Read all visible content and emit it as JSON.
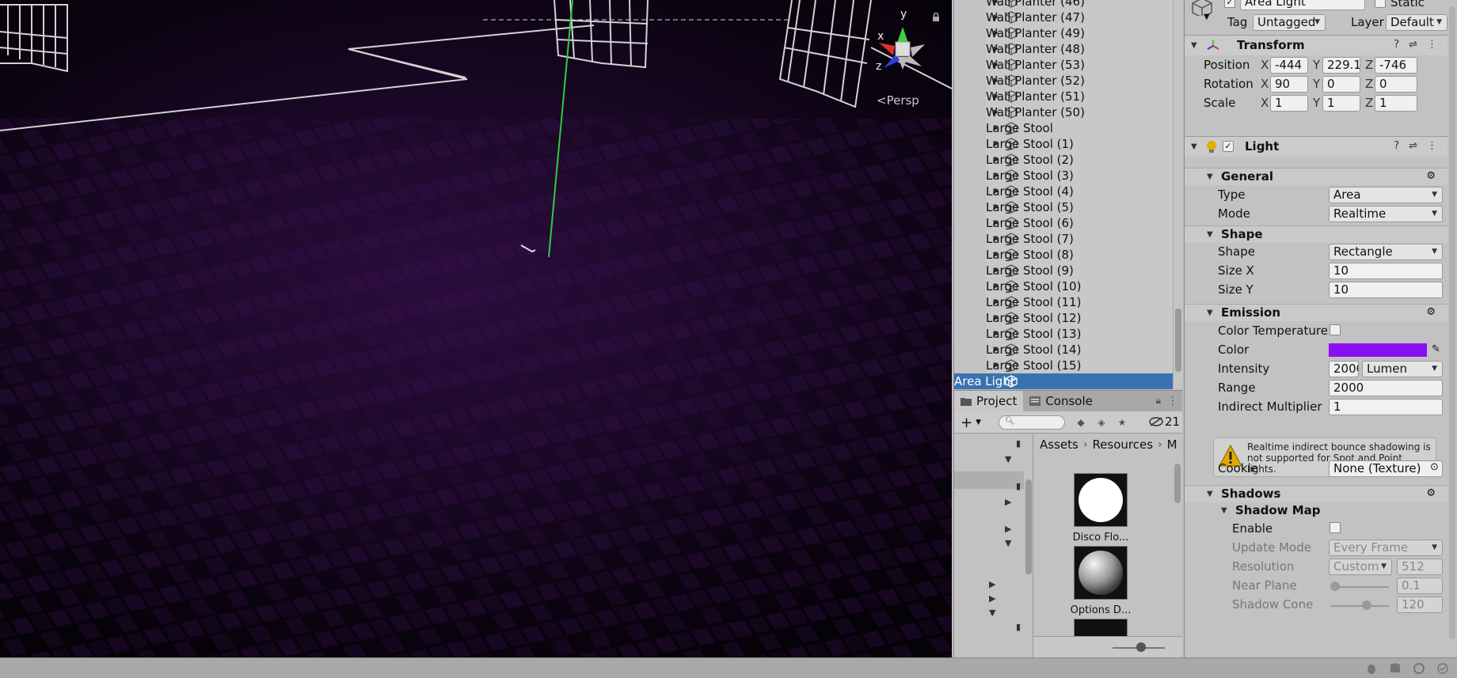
{
  "scene": {
    "projection_label": "Persp",
    "gizmo_axes": [
      "y",
      "x",
      "z"
    ]
  },
  "hierarchy": {
    "items": [
      {
        "label": "Wall Planter (46)",
        "selected": false
      },
      {
        "label": "Wall Planter (47)",
        "selected": false
      },
      {
        "label": "Wall Planter (49)",
        "selected": false
      },
      {
        "label": "Wall Planter (48)",
        "selected": false
      },
      {
        "label": "Wall Planter (53)",
        "selected": false
      },
      {
        "label": "Wall Planter (52)",
        "selected": false
      },
      {
        "label": "Wall Planter (51)",
        "selected": false
      },
      {
        "label": "Wall Planter (50)",
        "selected": false
      },
      {
        "label": "Large Stool",
        "selected": false
      },
      {
        "label": "Large Stool (1)",
        "selected": false
      },
      {
        "label": "Large Stool (2)",
        "selected": false
      },
      {
        "label": "Large Stool (3)",
        "selected": false
      },
      {
        "label": "Large Stool (4)",
        "selected": false
      },
      {
        "label": "Large Stool (5)",
        "selected": false
      },
      {
        "label": "Large Stool (6)",
        "selected": false
      },
      {
        "label": "Large Stool (7)",
        "selected": false
      },
      {
        "label": "Large Stool (8)",
        "selected": false
      },
      {
        "label": "Large Stool (9)",
        "selected": false
      },
      {
        "label": "Large Stool (10)",
        "selected": false
      },
      {
        "label": "Large Stool (11)",
        "selected": false
      },
      {
        "label": "Large Stool (12)",
        "selected": false
      },
      {
        "label": "Large Stool (13)",
        "selected": false
      },
      {
        "label": "Large Stool (14)",
        "selected": false
      },
      {
        "label": "Large Stool (15)",
        "selected": false
      },
      {
        "label": "Area Light",
        "selected": true
      }
    ]
  },
  "project": {
    "tabs": [
      {
        "label": "Project"
      },
      {
        "label": "Console"
      }
    ],
    "hidden_count": "21",
    "breadcrumb": [
      "Assets",
      "Resources",
      "M"
    ],
    "assets": [
      {
        "name": "Disco Flo..."
      },
      {
        "name": "Options D..."
      }
    ]
  },
  "inspector": {
    "object_name": "Area Light",
    "static_label": "Static",
    "tag_label": "Tag",
    "tag_value": "Untagged",
    "layer_label": "Layer",
    "layer_value": "Default",
    "transform": {
      "title": "Transform",
      "position_label": "Position",
      "rotation_label": "Rotation",
      "scale_label": "Scale",
      "axes": {
        "x": "X",
        "y": "Y",
        "z": "Z"
      },
      "position": {
        "x": "-444",
        "y": "229.1",
        "z": "-746"
      },
      "rotation": {
        "x": "90",
        "y": "0",
        "z": "0"
      },
      "scale": {
        "x": "1",
        "y": "1",
        "z": "1"
      }
    },
    "light": {
      "title": "Light",
      "general": {
        "title": "General",
        "type_label": "Type",
        "type_value": "Area",
        "mode_label": "Mode",
        "mode_value": "Realtime"
      },
      "shape": {
        "title": "Shape",
        "shape_label": "Shape",
        "shape_value": "Rectangle",
        "size_x_label": "Size X",
        "size_x_value": "10",
        "size_y_label": "Size Y",
        "size_y_value": "10"
      },
      "emission": {
        "title": "Emission",
        "color_temp_label": "Color Temperature",
        "color_label": "Color",
        "color_value": "#8a10f0",
        "intensity_label": "Intensity",
        "intensity_value": "2000",
        "intensity_unit": "Lumen",
        "range_label": "Range",
        "range_value": "2000",
        "indirect_label": "Indirect Multiplier",
        "indirect_value": "1",
        "warning": "Realtime indirect bounce shadowing is not supported for Spot and Point lights.",
        "cookie_label": "Cookie",
        "cookie_value": "None (Texture)"
      },
      "shadows": {
        "title": "Shadows",
        "shadow_map_title": "Shadow Map",
        "enable_label": "Enable",
        "update_mode_label": "Update Mode",
        "update_mode_value": "Every Frame",
        "resolution_label": "Resolution",
        "resolution_value": "Custom",
        "resolution_number": "512",
        "near_plane_label": "Near Plane",
        "near_plane_value": "0.1",
        "shadow_cone_label": "Shadow Cone",
        "shadow_cone_value": "120"
      }
    }
  },
  "colors": {
    "selection": "#3a72b0",
    "emission_color": "#8a10f0"
  }
}
